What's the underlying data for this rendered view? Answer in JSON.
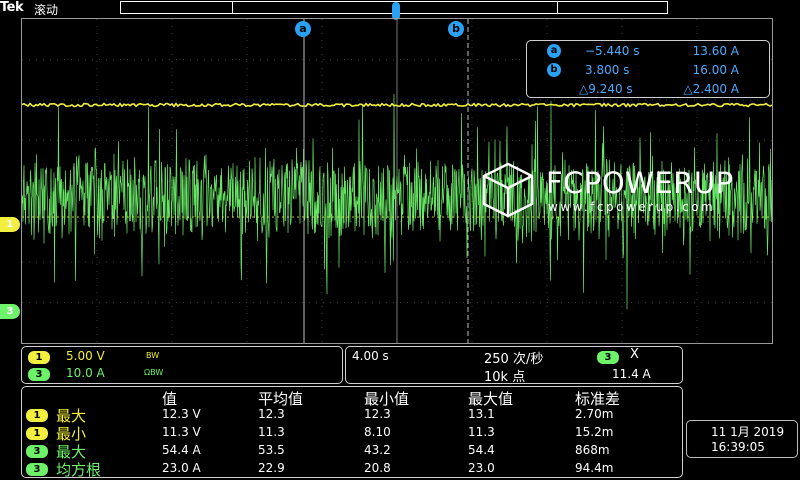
{
  "header": {
    "brand": "Tek",
    "mode": "滚动"
  },
  "cursors": {
    "a_label": "a",
    "b_label": "b"
  },
  "channels": [
    {
      "tag": "1",
      "color": "#f2ef3e"
    },
    {
      "tag": "3",
      "color": "#6ef26a"
    }
  ],
  "cursor_readout": {
    "rows": [
      {
        "badge": "a",
        "time": "−5.440 s",
        "value": "13.60 A"
      },
      {
        "badge": "b",
        "time": "3.800 s",
        "value": "16.00 A"
      },
      {
        "badge": "",
        "time": "△9.240 s",
        "value": "△2.400 A"
      }
    ]
  },
  "logo": {
    "name": "FCPOWERUP",
    "url": "www.fcpowerup.com"
  },
  "ch_settings": [
    {
      "ch": "1",
      "scale": "5.00 V",
      "suffix": "BW"
    },
    {
      "ch": "3",
      "scale": "10.0 A",
      "suffix": "ΩBW"
    }
  ],
  "timebase": {
    "time": "4.00 s",
    "rate": "250 次/秒",
    "points": "10k 点",
    "trigger_ch": "3",
    "trigger_icon": "X",
    "trigger_level": "11.4 A"
  },
  "measurements": {
    "headers": [
      "值",
      "平均值",
      "最小值",
      "最大值",
      "标准差"
    ],
    "rows": [
      {
        "ch": "1",
        "name": "最大",
        "value": "12.3 V",
        "mean": "12.3",
        "min": "12.3",
        "max": "13.1",
        "std": "2.70m"
      },
      {
        "ch": "1",
        "name": "最小",
        "value": "11.3 V",
        "mean": "11.3",
        "min": "8.10",
        "max": "11.3",
        "std": "15.2m"
      },
      {
        "ch": "3",
        "name": "最大",
        "value": "54.4 A",
        "mean": "53.5",
        "min": "43.2",
        "max": "54.4",
        "std": "868m"
      },
      {
        "ch": "3",
        "name": "均方根",
        "value": "23.0 A",
        "mean": "22.9",
        "min": "20.8",
        "max": "23.0",
        "std": "94.4m"
      }
    ]
  },
  "clock": {
    "date": "11 1月 2019",
    "time": "16:39:05"
  },
  "colors": {
    "ch1": "#f2ef3e",
    "ch3": "#6ef26a",
    "cursor": "#2aa1f2"
  }
}
